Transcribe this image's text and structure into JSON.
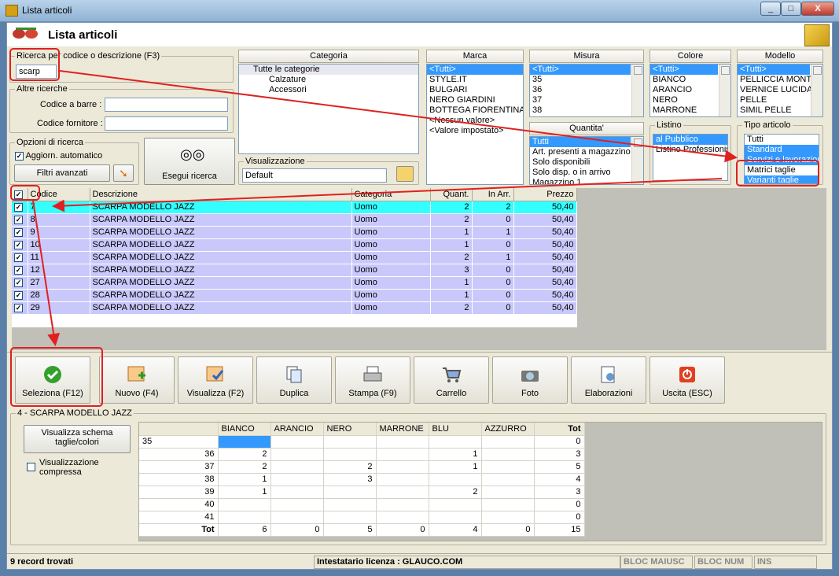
{
  "window": {
    "title": "Lista articoli",
    "min": "_",
    "max": "□",
    "close": "X"
  },
  "header": {
    "title": "Lista articoli"
  },
  "search": {
    "group": "Ricerca per codice o descrizione (F3)",
    "value": "scarp"
  },
  "altre": {
    "group": "Altre ricerche",
    "barcode_label": "Codice a barre :",
    "supplier_label": "Codice fornitore :"
  },
  "opzioni": {
    "group": "Opzioni di ricerca",
    "auto_label": "Aggiorn. automatico",
    "filters_btn": "Filtri avanzati",
    "search_btn": "Esegui ricerca"
  },
  "categoria": {
    "header": "Categoria",
    "root": "Tutte le categorie",
    "items": [
      "Calzature",
      "Accessori"
    ]
  },
  "visualizzazione": {
    "group": "Visualizzazione",
    "value": "Default"
  },
  "marca": {
    "header": "Marca",
    "items": [
      "<Tutti>",
      "STYLE.IT",
      "BULGARI",
      "NERO GIARDINI",
      "BOTTEGA FIORENTINA",
      "<Nessun valore>",
      "<Valore impostato>"
    ]
  },
  "misura": {
    "header": "Misura",
    "items": [
      "<Tutti>",
      "35",
      "36",
      "37",
      "38"
    ]
  },
  "quantita": {
    "header": "Quantita'",
    "items": [
      "Tutti",
      "Art. presenti a magazzino",
      "Solo disponibili",
      "Solo disp. o in arrivo",
      "Magazzino 1"
    ]
  },
  "colore": {
    "header": "Colore",
    "items": [
      "<Tutti>",
      "BIANCO",
      "ARANCIO",
      "NERO",
      "MARRONE"
    ]
  },
  "listino": {
    "group": "Listino",
    "items": [
      "al Pubblico",
      "Listino Professionisti"
    ]
  },
  "modello": {
    "header": "Modello",
    "items": [
      "<Tutti>",
      "PELLICCIA MONT",
      "VERNICE LUCIDA",
      "PELLE",
      "SIMIL PELLE"
    ]
  },
  "tipo": {
    "group": "Tipo articolo",
    "items": [
      "Tutti",
      "Standard",
      "Servizi e lavorazion",
      "Matrici taglie",
      "Varianti taglie"
    ]
  },
  "grid": {
    "columns": [
      "Codice",
      "Descrizione",
      "Categoria",
      "Quant.",
      "In Arr.",
      "Prezzo"
    ],
    "rows": [
      [
        "7",
        "SCARPA MODELLO JAZZ",
        "Uomo",
        "2",
        "2",
        "50,40"
      ],
      [
        "8",
        "SCARPA MODELLO JAZZ",
        "Uomo",
        "2",
        "0",
        "50,40"
      ],
      [
        "9",
        "SCARPA MODELLO JAZZ",
        "Uomo",
        "1",
        "1",
        "50,40"
      ],
      [
        "10",
        "SCARPA MODELLO JAZZ",
        "Uomo",
        "1",
        "0",
        "50,40"
      ],
      [
        "11",
        "SCARPA MODELLO JAZZ",
        "Uomo",
        "2",
        "1",
        "50,40"
      ],
      [
        "12",
        "SCARPA MODELLO JAZZ",
        "Uomo",
        "3",
        "0",
        "50,40"
      ],
      [
        "27",
        "SCARPA MODELLO JAZZ",
        "Uomo",
        "1",
        "0",
        "50,40"
      ],
      [
        "28",
        "SCARPA MODELLO JAZZ",
        "Uomo",
        "1",
        "0",
        "50,40"
      ],
      [
        "29",
        "SCARPA MODELLO JAZZ",
        "Uomo",
        "2",
        "0",
        "50,40"
      ]
    ]
  },
  "toolbar": [
    "Seleziona (F12)",
    "Nuovo (F4)",
    "Visualizza (F2)",
    "Duplica",
    "Stampa (F9)",
    "Carrello",
    "Foto",
    "Elaborazioni",
    "Uscita (ESC)"
  ],
  "detail": {
    "group": "4 - SCARPA MODELLO JAZZ",
    "schema_btn": "Visualizza schema taglie/colori",
    "compress_label": "Visualizzazione compressa",
    "colors": [
      "BIANCO",
      "ARANCIO",
      "NERO",
      "MARRONE",
      "BLU",
      "AZZURRO",
      "Tot"
    ],
    "rows": [
      [
        "35",
        "",
        "",
        "",
        "",
        "",
        "",
        "0"
      ],
      [
        "36",
        "2",
        "",
        "",
        "",
        "1",
        "",
        "3"
      ],
      [
        "37",
        "2",
        "",
        "2",
        "",
        "1",
        "",
        "5"
      ],
      [
        "38",
        "1",
        "",
        "3",
        "",
        "",
        "",
        "4"
      ],
      [
        "39",
        "1",
        "",
        "",
        "",
        "2",
        "",
        "3"
      ],
      [
        "40",
        "",
        "",
        "",
        "",
        "",
        "",
        "0"
      ],
      [
        "41",
        "",
        "",
        "",
        "",
        "",
        "",
        "0"
      ],
      [
        "Tot",
        "6",
        "0",
        "5",
        "0",
        "4",
        "0",
        "15"
      ]
    ]
  },
  "status": {
    "records": "9 record trovati",
    "license": "Intestatario licenza : GLAUCO.COM",
    "caps": "BLOC MAIUSC",
    "num": "BLOC NUM",
    "ins": "INS"
  },
  "colors": {
    "selection": "#3399ff",
    "row_lavender": "#c8c8fb",
    "row_cyan": "#33ffff",
    "highlight": "#e02020"
  }
}
